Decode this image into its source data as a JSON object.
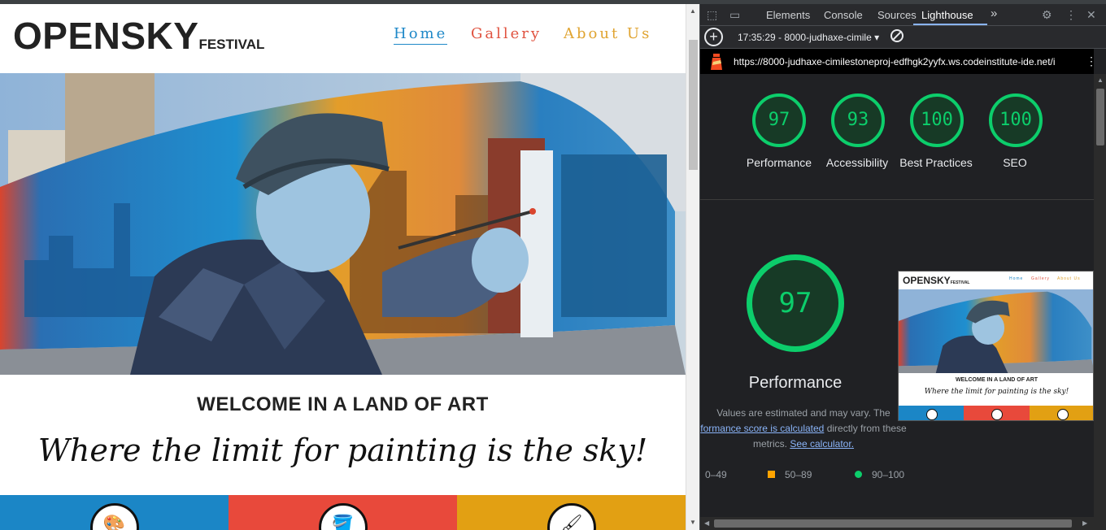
{
  "site": {
    "logo_main": "OPENSKY",
    "logo_sub": "FESTIVAL",
    "nav": {
      "home": "Home",
      "gallery": "Gallery",
      "about": "About Us"
    },
    "welcome": "WELCOME IN A LAND OF ART",
    "tagline": "Where the limit for painting is the sky!",
    "tiles": [
      {
        "color": "#1b86c6",
        "icon": "palette-icon"
      },
      {
        "color": "#e8493b",
        "icon": "paint-bucket-icon"
      },
      {
        "color": "#e2a013",
        "icon": "paintbrush-icon"
      }
    ],
    "hero_alt": "mural-painter-icon"
  },
  "devtools": {
    "tabs": [
      "Elements",
      "Console",
      "Sources",
      "Lighthouse"
    ],
    "active_tab": "Lighthouse",
    "more_tabs": "»",
    "report_label": "17:35:29 - 8000-judhaxe-cimile",
    "url": "https://8000-judhaxe-cimilestoneproj-edfhgk2yyfx.ws.codeinstitute-ide.net/in...",
    "scores": [
      {
        "value": "97",
        "label": "Performance"
      },
      {
        "value": "93",
        "label": "Accessibility"
      },
      {
        "value": "100",
        "label": "Best Practices"
      },
      {
        "value": "100",
        "label": "SEO"
      }
    ],
    "performance": {
      "score": "97",
      "title": "Performance",
      "note_1": "Values are estimated and may vary. The",
      "note_link": "formance score is calculated",
      "note_2": "directly from these",
      "note_3": "metrics.",
      "calc_link": "See calculator."
    },
    "legend": {
      "fail": "0–49",
      "average": "50–89",
      "pass": "90–100"
    },
    "colors": {
      "pass": "#0cce6b",
      "average": "#ffa400",
      "accent": "#8ab4f8"
    }
  }
}
